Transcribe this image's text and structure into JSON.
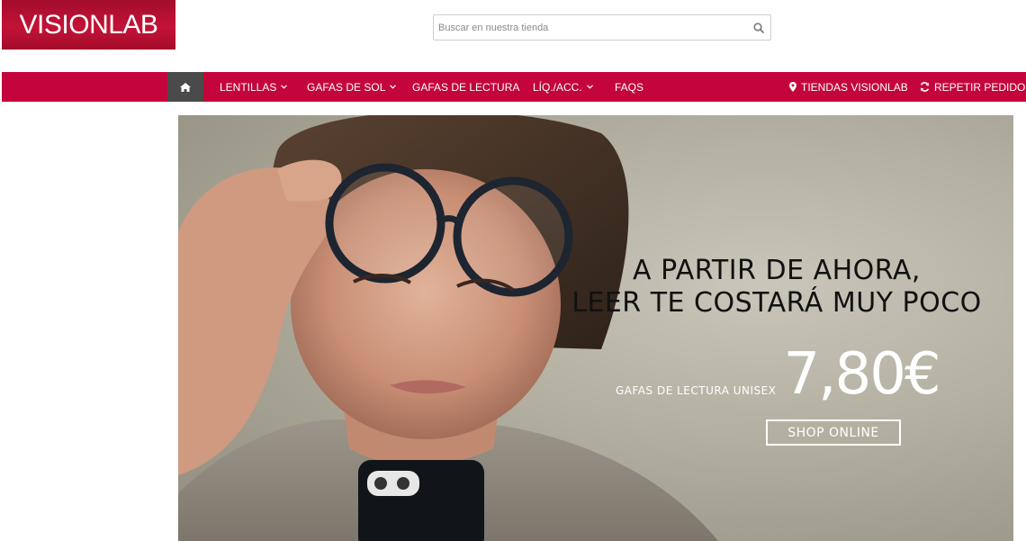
{
  "brand": {
    "name": "VISIONLAB",
    "color": "#c4053b"
  },
  "search": {
    "placeholder": "Buscar en nuestra tienda",
    "value": "",
    "icon": "search-icon"
  },
  "nav": {
    "home_icon": "home-icon",
    "items": [
      {
        "label": "LENTILLAS",
        "has_dropdown": true
      },
      {
        "label": "GAFAS DE SOL",
        "has_dropdown": true
      },
      {
        "label": "GAFAS DE LECTURA",
        "has_dropdown": false
      },
      {
        "label": "LÍQ./ACC.",
        "has_dropdown": true
      },
      {
        "label": "FAQS",
        "has_dropdown": false
      }
    ],
    "right": [
      {
        "label": "TIENDAS VISIONLAB",
        "icon": "map-marker-icon"
      },
      {
        "label": "REPETIR PEDIDO",
        "icon": "refresh-icon"
      }
    ]
  },
  "hero": {
    "headline_line1": "A PARTIR DE AHORA,",
    "headline_line2": "LEER TE COSTARÁ MUY POCO",
    "price_label": "GAFAS DE LECTURA UNISEX",
    "price": "7,80€",
    "cta_label": "SHOP ONLINE"
  }
}
